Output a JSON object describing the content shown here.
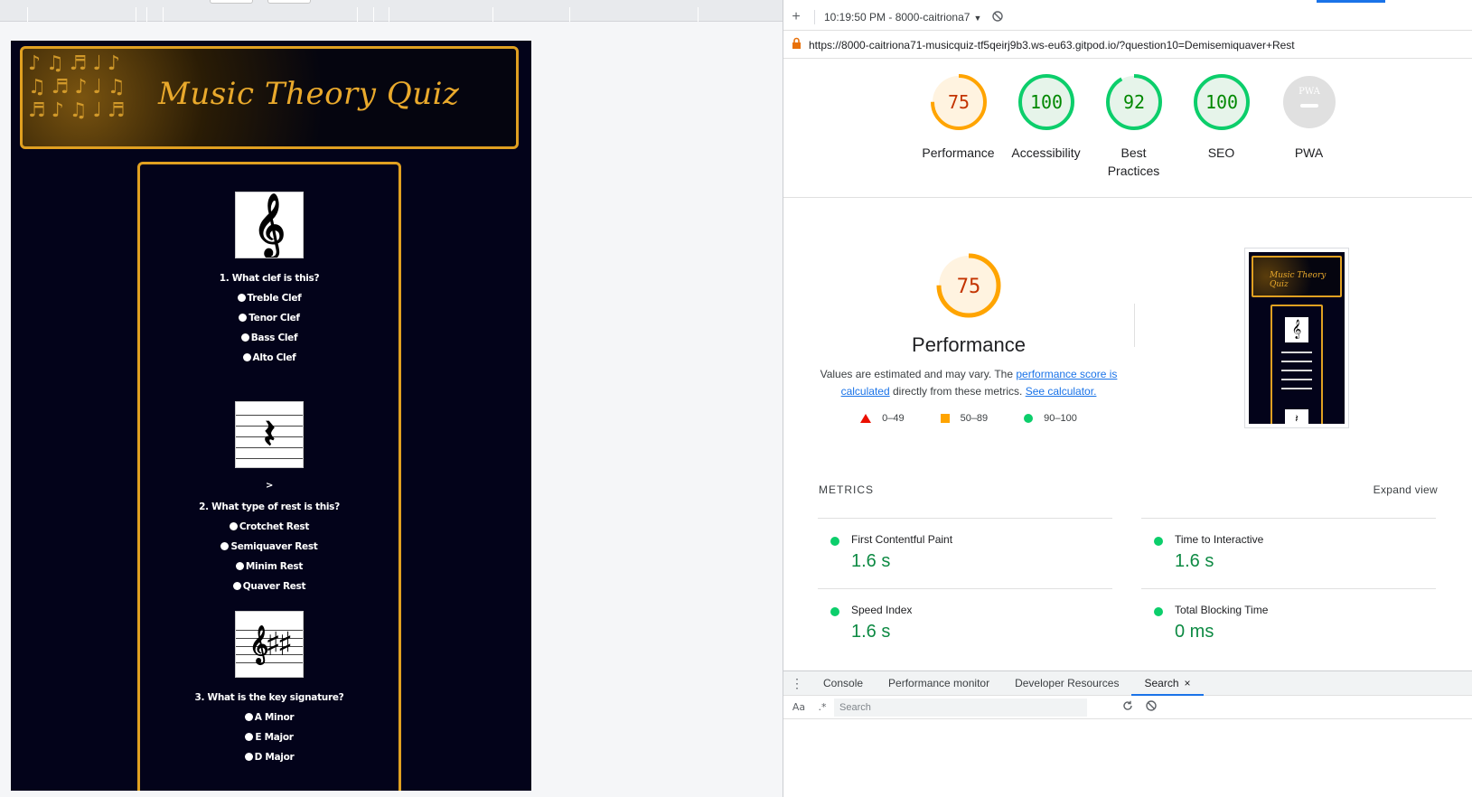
{
  "quiz": {
    "title": "Music Theory Quiz",
    "header_notes": "♪♫♬♩♪ ♫♬♪♩♫ ♬♪♫♩♬",
    "questions": [
      {
        "text": "1. What clef is this?",
        "image_glyph": "𝄞",
        "options": [
          "Treble Clef",
          "Tenor Clef",
          "Bass Clef",
          "Alto Clef"
        ]
      },
      {
        "text": "2. What type of rest is this?",
        "image_glyph": "𝄽",
        "prefix": ">",
        "options": [
          "Crotchet Rest",
          "Semiquaver Rest",
          "Minim Rest",
          "Quaver Rest"
        ]
      },
      {
        "text": "3. What is the key signature?",
        "image_glyph": "𝄞♯♯",
        "options": [
          "A Minor",
          "E Major",
          "D Major"
        ]
      }
    ]
  },
  "devtools": {
    "toolbar": {
      "add_icon": "+",
      "report_time": "10:19:50 PM - 8000-caitriona7",
      "report_caret": "▼",
      "clear_icon": "⃠"
    },
    "url": "https://8000-caitriona71-musicquiz-tf5qeirj9b3.ws-eu63.gitpod.io/?question10=Demisemiquaver+Rest",
    "categories": [
      {
        "score": "75",
        "label": "Performance",
        "value": 75,
        "color": "#ffa400",
        "bg": "#fff3e0",
        "text_color": "#c33300"
      },
      {
        "score": "100",
        "label": "Accessibility",
        "value": 100,
        "color": "#0cce6b",
        "bg": "#e6f4ea",
        "text_color": "#008800"
      },
      {
        "score": "92",
        "label": "Best Practices",
        "value": 92,
        "color": "#0cce6b",
        "bg": "#e6f4ea",
        "text_color": "#008800"
      },
      {
        "score": "100",
        "label": "SEO",
        "value": 100,
        "color": "#0cce6b",
        "bg": "#e6f4ea",
        "text_color": "#008800"
      },
      {
        "score": "PWA",
        "label": "PWA",
        "value": 0,
        "color": "#e0e0e0",
        "bg": "#e0e0e0",
        "text_color": "#ffffff"
      }
    ],
    "performance": {
      "score": "75",
      "heading": "Performance",
      "desc_prefix": "Values are estimated and may vary. The ",
      "desc_link1": "performance score is calculated",
      "desc_middle": " directly from these metrics. ",
      "desc_link2": "See calculator.",
      "legend": [
        "0–49",
        "50–89",
        "90–100"
      ]
    },
    "thumbnail": {
      "title": "Music Theory Quiz",
      "glyph": "𝄞",
      "glyph2": "𝄽"
    },
    "metrics": {
      "label": "METRICS",
      "expand": "Expand view",
      "items": [
        {
          "title": "First Contentful Paint",
          "value": "1.6 s"
        },
        {
          "title": "Time to Interactive",
          "value": "1.6 s"
        },
        {
          "title": "Speed Index",
          "value": "1.6 s"
        },
        {
          "title": "Total Blocking Time",
          "value": "0 ms"
        }
      ]
    },
    "drawer": {
      "tabs": [
        "Console",
        "Performance monitor",
        "Developer Resources",
        "Search"
      ],
      "close": "×",
      "match_case": "Aa",
      "regex": ".*",
      "search_placeholder": "Search"
    }
  }
}
